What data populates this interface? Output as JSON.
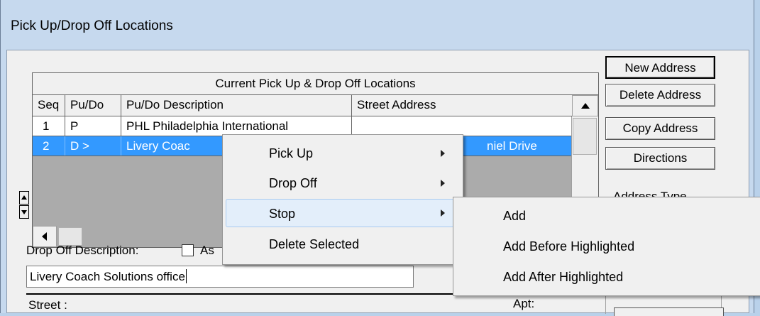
{
  "window": {
    "title": "Pick Up/Drop Off Locations"
  },
  "grid": {
    "caption": "Current Pick Up & Drop Off Locations",
    "columns": [
      "Seq",
      "Pu/Do",
      "Pu/Do Description",
      "Street Address"
    ],
    "rows": [
      {
        "seq": "1",
        "pudo": "P",
        "description": "PHL Philadelphia International",
        "street": ""
      },
      {
        "seq": "2",
        "pudo": "D >",
        "description": "Livery Coac",
        "street": "niel Drive",
        "selected": true
      }
    ]
  },
  "buttons": {
    "new_address": "New Address",
    "delete_address": "Delete Address",
    "copy_address": "Copy Address",
    "directions": "Directions"
  },
  "address_type": {
    "label": "Address Type"
  },
  "drop_off": {
    "label": "Drop Off Description:",
    "checkbox_label": "As",
    "value": "Livery Coach Solutions office"
  },
  "street": {
    "label": "Street :"
  },
  "apt": {
    "label": "Apt:"
  },
  "context_menu": {
    "items": [
      "Pick Up",
      "Drop Off",
      "Stop",
      "Delete Selected"
    ],
    "highlighted": "Stop"
  },
  "submenu": {
    "items": [
      "Add",
      "Add Before Highlighted",
      "Add After Highlighted"
    ]
  }
}
